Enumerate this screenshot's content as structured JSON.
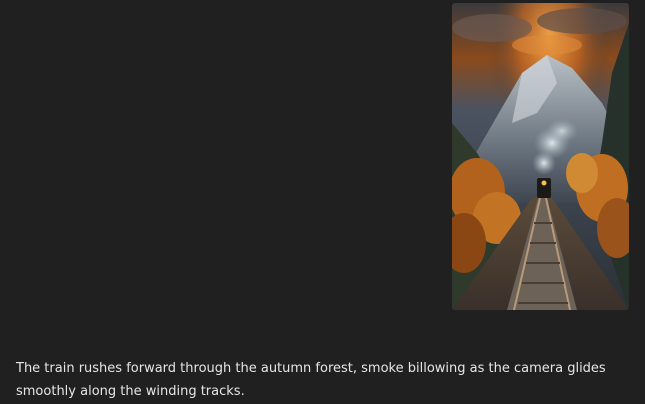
{
  "message": {
    "image": {
      "alt_icon": "image-icon"
    },
    "caption": "The train rushes forward through the autumn forest, smoke billowing as the camera glides smoothly along the winding tracks."
  },
  "colors": {
    "background": "#202020",
    "caption_text": "#e6e6e6"
  }
}
